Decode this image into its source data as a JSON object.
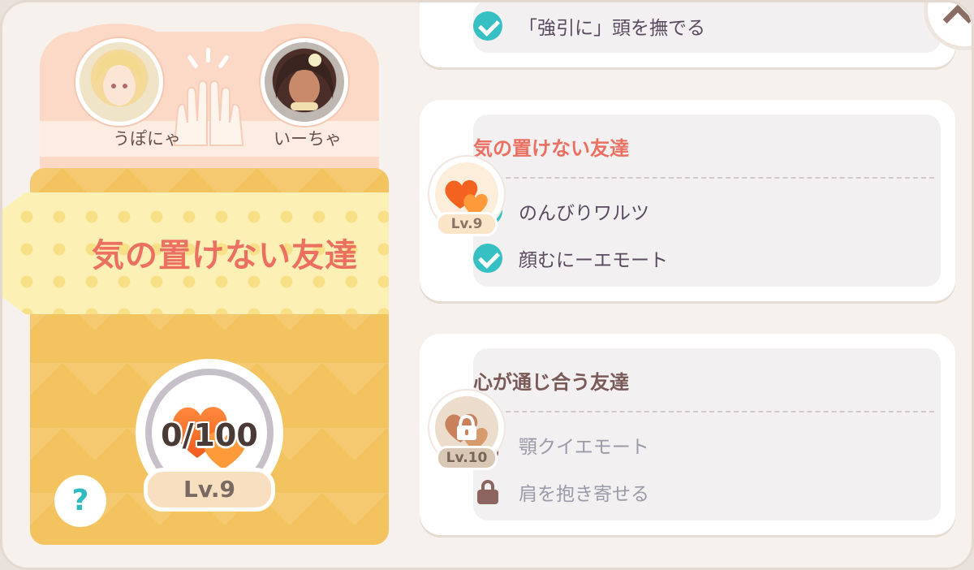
{
  "pair": {
    "player_left": "うぽにゃ",
    "player_right": "いーちゃ"
  },
  "current": {
    "title": "気の置けない友達",
    "progress": "0/100",
    "level": "Lv.9",
    "help_label": "?"
  },
  "rewards": {
    "top_partial": {
      "item_text": "「強引に」頭を撫でる"
    },
    "tier_lv9": {
      "level": "Lv.9",
      "title": "気の置けない友達",
      "items": [
        "のんびりワルツ",
        "顔むにーエモート"
      ]
    },
    "tier_lv10": {
      "level": "Lv.10",
      "title": "心が通じ合う友達",
      "items": [
        "顎クイエモート",
        "肩を抱き寄せる"
      ]
    }
  },
  "colors": {
    "accent_title": "#ec7062",
    "locked_title": "#7a5a58",
    "check": "#36c0c4",
    "lock": "#8c6460",
    "card_yellow": "#f3c35f"
  },
  "icons": [
    "heart-icon",
    "check-icon",
    "lock-icon",
    "question-icon",
    "chevron-up-icon",
    "high-five-icon"
  ]
}
